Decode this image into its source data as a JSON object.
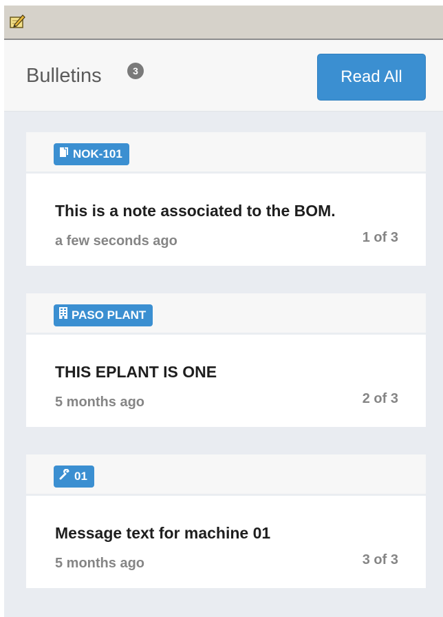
{
  "window": {
    "icon": "edit-pencil-icon"
  },
  "header": {
    "title": "Bulletins",
    "count": "3",
    "read_all_label": "Read All"
  },
  "bulletins": [
    {
      "tag_icon": "document-icon",
      "tag": "NOK-101",
      "message": "This is a note associated to the BOM.",
      "time": "a few seconds ago",
      "position": "1 of 3"
    },
    {
      "tag_icon": "building-icon",
      "tag": "PASO PLANT",
      "message": "THIS EPLANT IS ONE",
      "time": "5 months ago",
      "position": "2 of 3"
    },
    {
      "tag_icon": "wrench-icon",
      "tag": "01",
      "message": "Message text for machine 01",
      "time": "5 months ago",
      "position": "3 of 3"
    }
  ],
  "colors": {
    "accent": "#3b8fd1",
    "panel_background": "#e9ecf1",
    "muted_text": "#858585"
  }
}
